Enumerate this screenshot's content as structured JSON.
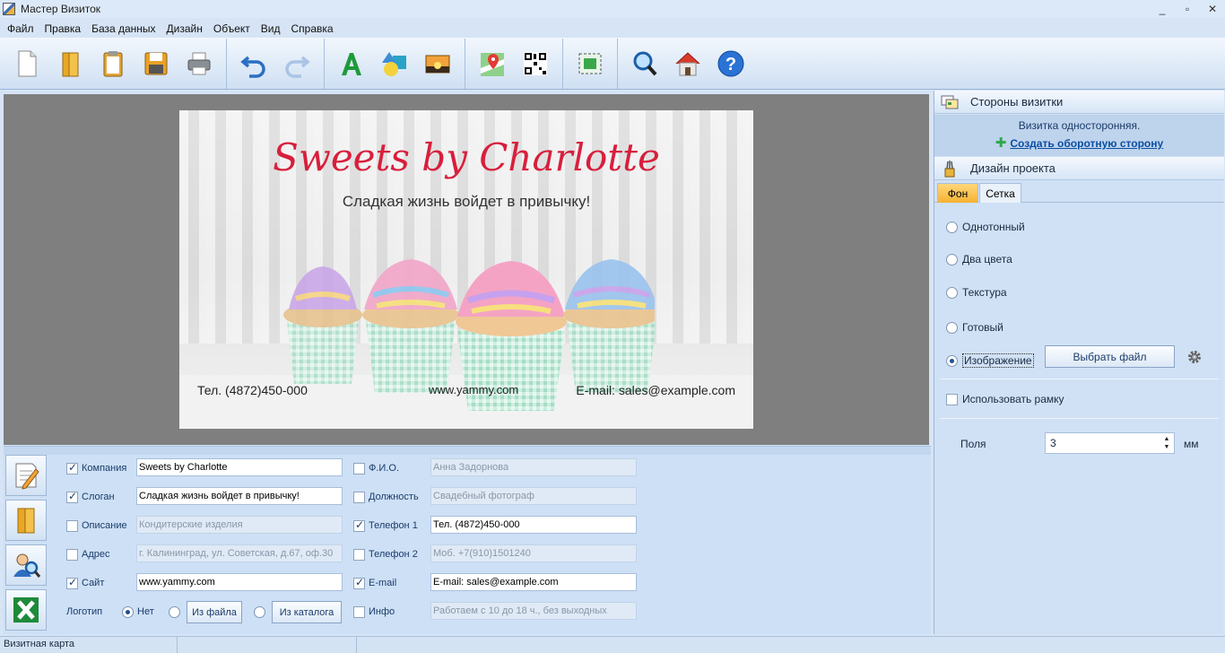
{
  "window": {
    "title": "Мастер Визиток",
    "controls": [
      "_",
      "▫",
      "✕"
    ]
  },
  "menu": [
    "Файл",
    "Правка",
    "База данных",
    "Дизайн",
    "Объект",
    "Вид",
    "Справка"
  ],
  "toolbar": {
    "groups": [
      [
        "new-document-icon",
        "open-folder-icon",
        "clipboard-icon",
        "save-icon",
        "print-icon"
      ],
      [
        "undo-icon",
        "redo-icon"
      ],
      [
        "text-icon",
        "shapes-icon",
        "image-icon"
      ],
      [
        "map-icon",
        "qr-code-icon"
      ],
      [
        "crop-icon"
      ],
      [
        "zoom-icon",
        "home-icon",
        "help-icon"
      ]
    ]
  },
  "card": {
    "brand": "Sweets by Charlotte",
    "slogan": "Сладкая жизнь войдет в привычку!",
    "phone": "Тел. (4872)450-000",
    "site": "www.yammy.com",
    "email": "E-mail: sales@example.com",
    "brand_color": "#d81f3c"
  },
  "fields": {
    "left": [
      {
        "label": "Компания",
        "checked": true,
        "value": "Sweets by Charlotte"
      },
      {
        "label": "Слоган",
        "checked": true,
        "value": "Сладкая жизнь войдет в привычку!"
      },
      {
        "label": "Описание",
        "checked": false,
        "value": "Кондитерские изделия"
      },
      {
        "label": "Адрес",
        "checked": false,
        "value": "г. Калининград, ул. Советская, д.67, оф.30"
      },
      {
        "label": "Сайт",
        "checked": true,
        "value": "www.yammy.com"
      }
    ],
    "right": [
      {
        "label": "Ф.И.О.",
        "checked": false,
        "value": "Анна Задорнова"
      },
      {
        "label": "Должность",
        "checked": false,
        "value": "Свадебный фотограф"
      },
      {
        "label": "Телефон 1",
        "checked": true,
        "value": "Тел. (4872)450-000"
      },
      {
        "label": "Телефон 2",
        "checked": false,
        "value": "Моб. +7(910)1501240"
      },
      {
        "label": "E-mail",
        "checked": true,
        "value": "E-mail: sales@example.com"
      },
      {
        "label": "Инфо",
        "checked": false,
        "value": "Работаем с 10 до 18 ч., без выходных"
      }
    ],
    "logo": {
      "label": "Логотип",
      "none_label": "Нет",
      "from_file_label": "Из файла",
      "from_catalog_label": "Из каталога",
      "selected": "Нет"
    }
  },
  "status": {
    "text": "Визитная карта"
  },
  "right_panel": {
    "sides_title": "Стороны визитки",
    "sides_info": "Визитка односторонняя.",
    "create_back": "Создать оборотную сторону",
    "design_title": "Дизайн проекта",
    "tabs": [
      {
        "label": "Фон",
        "active": true
      },
      {
        "label": "Сетка",
        "active": false
      }
    ],
    "bg_options": [
      {
        "label": "Однотонный",
        "selected": false
      },
      {
        "label": "Два цвета",
        "selected": false
      },
      {
        "label": "Текстура",
        "selected": false
      },
      {
        "label": "Готовый",
        "selected": false
      },
      {
        "label": "Изображение",
        "selected": true
      }
    ],
    "choose_file": "Выбрать файл",
    "use_frame_label": "Использовать рамку",
    "use_frame": false,
    "margins_label": "Поля",
    "margins_value": "3",
    "margins_unit": "мм"
  }
}
